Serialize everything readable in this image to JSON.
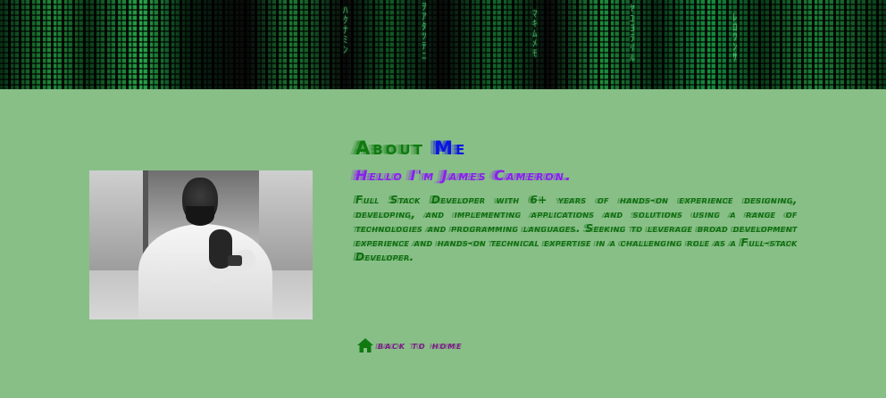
{
  "banner": {
    "alt": "matrix-code-banner"
  },
  "photo": {
    "alt": "portrait-photo"
  },
  "about": {
    "heading_word1": "About",
    "heading_word2": "Me",
    "subheading": "Hello I'm James Cameron.",
    "description": "Full Stack Developer with 6+ years of hands-on experience designing, developing, and implementing applications and solutions using a range of technologies and programming languages. Seeking to leverage broad development experience and hands-on technical expertise in a challenging role as a Full-stack Developer."
  },
  "nav": {
    "back_label": "back to home",
    "back_icon": "home-icon"
  },
  "colors": {
    "background": "#88bf87",
    "heading_green": "#0f7a10",
    "heading_blue": "#0a16e0",
    "subheading_purple": "#8a1ff0",
    "link_purple": "#7a1a86",
    "home_icon_green": "#0f7a10"
  }
}
